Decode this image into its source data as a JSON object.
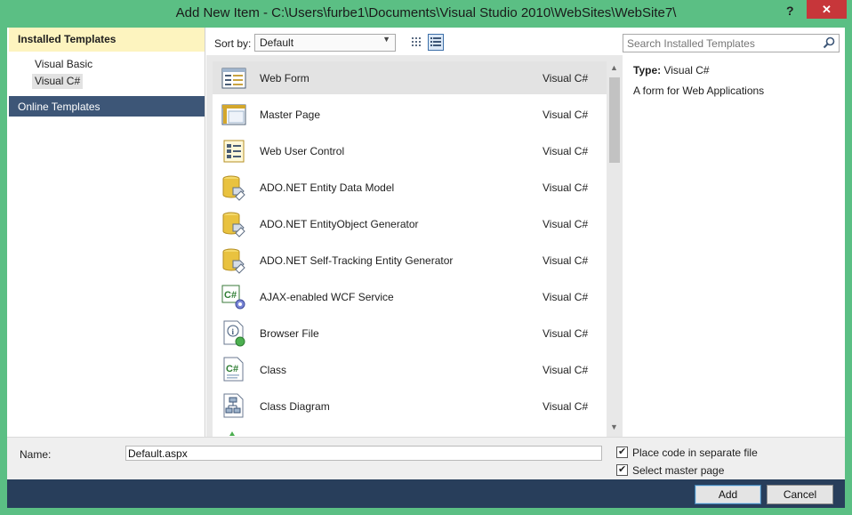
{
  "window": {
    "title": "Add New Item - C:\\Users\\furbe1\\Documents\\Visual Studio 2010\\WebSites\\WebSite7\\",
    "help_label": "?",
    "close_label": "✕"
  },
  "left": {
    "installed_header": "Installed Templates",
    "tree": [
      {
        "label": "Visual Basic"
      },
      {
        "label": "Visual C#",
        "selected": true
      }
    ],
    "online_header": "Online Templates"
  },
  "toolbar": {
    "sort_label": "Sort by:",
    "sort_value": "Default",
    "sort_arrow": "▼"
  },
  "list": {
    "items": [
      {
        "name": "Web Form",
        "lang": "Visual C#",
        "icon": "web-form-icon",
        "selected": true
      },
      {
        "name": "Master Page",
        "lang": "Visual C#",
        "icon": "master-page-icon"
      },
      {
        "name": "Web User Control",
        "lang": "Visual C#",
        "icon": "web-user-control-icon"
      },
      {
        "name": "ADO.NET Entity Data Model",
        "lang": "Visual C#",
        "icon": "database-icon"
      },
      {
        "name": "ADO.NET EntityObject Generator",
        "lang": "Visual C#",
        "icon": "database-icon"
      },
      {
        "name": "ADO.NET Self-Tracking Entity Generator",
        "lang": "Visual C#",
        "icon": "database-icon"
      },
      {
        "name": "AJAX-enabled WCF Service",
        "lang": "Visual C#",
        "icon": "wcf-service-icon"
      },
      {
        "name": "Browser File",
        "lang": "Visual C#",
        "icon": "browser-file-icon"
      },
      {
        "name": "Class",
        "lang": "Visual C#",
        "icon": "class-icon"
      },
      {
        "name": "Class Diagram",
        "lang": "Visual C#",
        "icon": "class-diagram-icon"
      }
    ],
    "scroll_up": "▲",
    "scroll_down": "▼"
  },
  "details": {
    "search_placeholder": "Search Installed Templates",
    "type_label": "Type:",
    "type_value": "Visual C#",
    "description": "A form for Web Applications"
  },
  "bottom": {
    "name_label": "Name:",
    "name_value": "Default.aspx",
    "checkbox_separate_file": "Place code in separate file",
    "checkbox_master_page": "Select master page",
    "add_label": "Add",
    "cancel_label": "Cancel"
  },
  "colors": {
    "window_border": "#5bbf84",
    "close_button": "#c7363a",
    "selected_header": "#fdf4bf",
    "online_header": "#3d5677",
    "footer": "#283e5b"
  }
}
